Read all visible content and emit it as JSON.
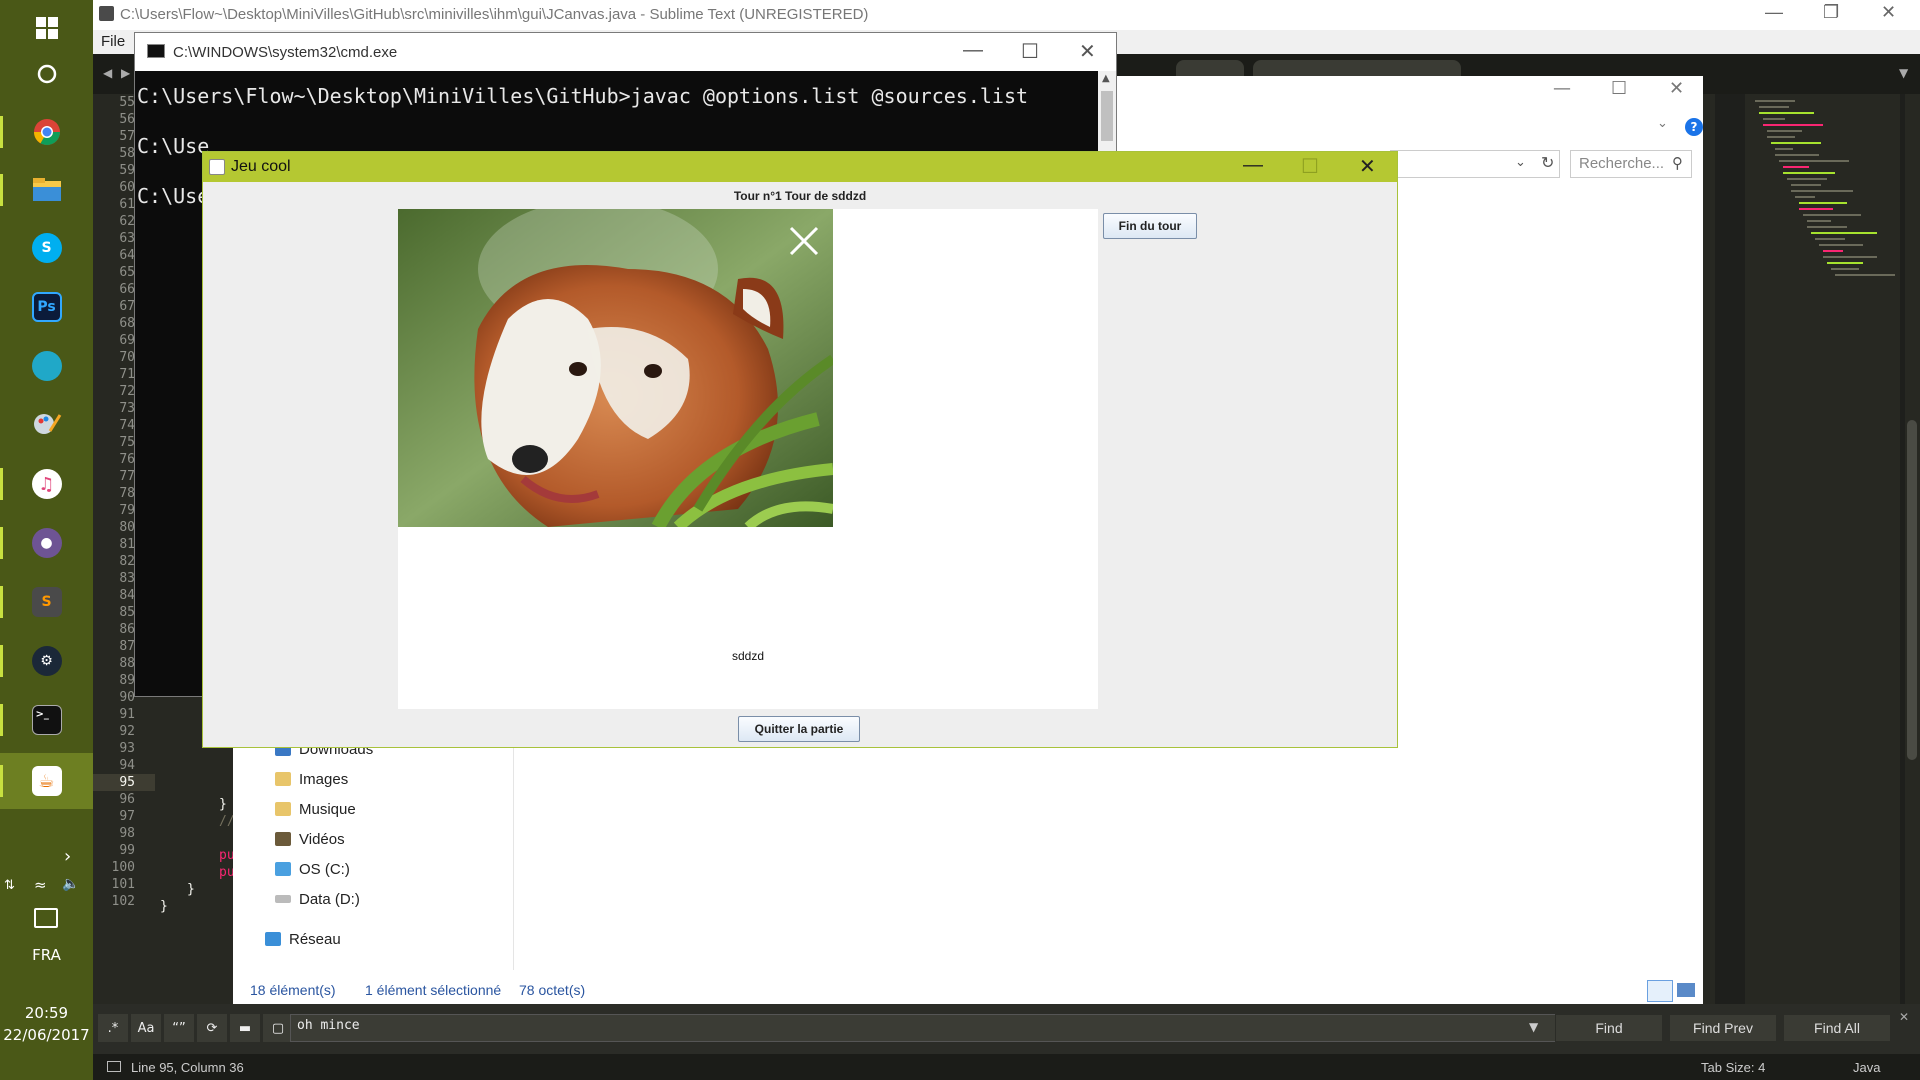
{
  "sublime": {
    "title": "C:\\Users\\Flow~\\Desktop\\MiniVilles\\GitHub\\src\\minivilles\\ihm\\gui\\JCanvas.java - Sublime Text (UNREGISTERED)",
    "menu_file": "File",
    "line_numbers": [
      "55",
      "56",
      "57",
      "58",
      "59",
      "60",
      "61",
      "62",
      "63",
      "64",
      "65",
      "66",
      "67",
      "68",
      "69",
      "70",
      "71",
      "72",
      "73",
      "74",
      "75",
      "76",
      "77",
      "78",
      "79",
      "80",
      "81",
      "82",
      "83",
      "84",
      "85",
      "86",
      "87",
      "88",
      "89",
      "90",
      "91",
      "92",
      "93",
      "94",
      "95",
      "96",
      "97",
      "98",
      "99",
      "100",
      "101",
      "102"
    ],
    "code_fragments": [
      "}",
      "//",
      "pu",
      "pu",
      "}",
      "}"
    ],
    "find": {
      "regex_label": ".*",
      "case_label": "Aa",
      "word_label": "“”",
      "value": "oh mince",
      "find_label": "Find",
      "find_prev_label": "Find Prev",
      "find_all_label": "Find All"
    },
    "status": {
      "position": "Line 95, Column 36",
      "tab_size": "Tab Size: 4",
      "syntax": "Java"
    }
  },
  "cmd": {
    "title": "C:\\WINDOWS\\system32\\cmd.exe",
    "lines": [
      "C:\\Users\\Flow~\\Desktop\\MiniVilles\\GitHub>javac @options.list @sources.list",
      "C:\\Use",
      "C:\\Use"
    ]
  },
  "explorer": {
    "search_placeholder": "Recherche...",
    "nav": [
      "Downloads",
      "Images",
      "Musique",
      "Vidéos",
      "OS (C:)",
      "Data (D:)",
      "Réseau"
    ],
    "status": {
      "count": "18 élément(s)",
      "selected": "1 élément sélectionné",
      "size": "78 octet(s)"
    }
  },
  "game": {
    "title": "Jeu cool",
    "turn_label": "Tour n°1  Tour de sddzd",
    "player_name": "sddzd",
    "end_turn_label": "Fin du tour",
    "quit_label": "Quitter la partie"
  },
  "taskbar": {
    "icons": [
      "windows-start-icon",
      "cortana-icon",
      "chrome-icon",
      "file-explorer-icon",
      "skype-icon",
      "photoshop-icon",
      "app-globe-icon",
      "paint-icon",
      "itunes-icon",
      "github-icon",
      "sublime-text-icon",
      "steam-icon",
      "cmd-icon",
      "java-icon"
    ],
    "language": "FRA",
    "time": "20:59",
    "date": "22/06/2017"
  }
}
